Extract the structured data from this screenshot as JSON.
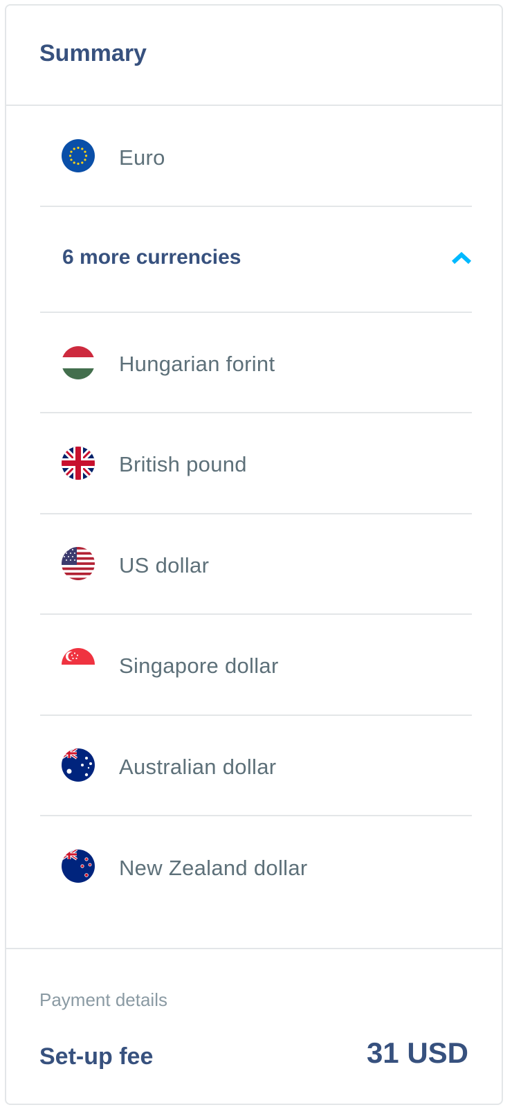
{
  "summary": {
    "title": "Summary"
  },
  "currencies": {
    "primary": {
      "label": "Euro",
      "flag": "eu-flag-icon"
    },
    "more_toggle": {
      "label": "6 more currencies",
      "icon": "chevron-up-icon",
      "accent": "#00b9ff"
    },
    "more": [
      {
        "label": "Hungarian forint",
        "flag": "hungary-flag-icon"
      },
      {
        "label": "British pound",
        "flag": "uk-flag-icon"
      },
      {
        "label": "US dollar",
        "flag": "us-flag-icon"
      },
      {
        "label": "Singapore dollar",
        "flag": "singapore-flag-icon"
      },
      {
        "label": "Australian dollar",
        "flag": "australia-flag-icon"
      },
      {
        "label": "New Zealand dollar",
        "flag": "new-zealand-flag-icon"
      }
    ]
  },
  "payment": {
    "heading": "Payment details",
    "fee_label": "Set-up fee",
    "fee_value": "31 USD"
  },
  "colors": {
    "title": "#37517e",
    "text": "#5d7079",
    "muted": "#8a9aa3",
    "divider": "#e3e6e8"
  }
}
